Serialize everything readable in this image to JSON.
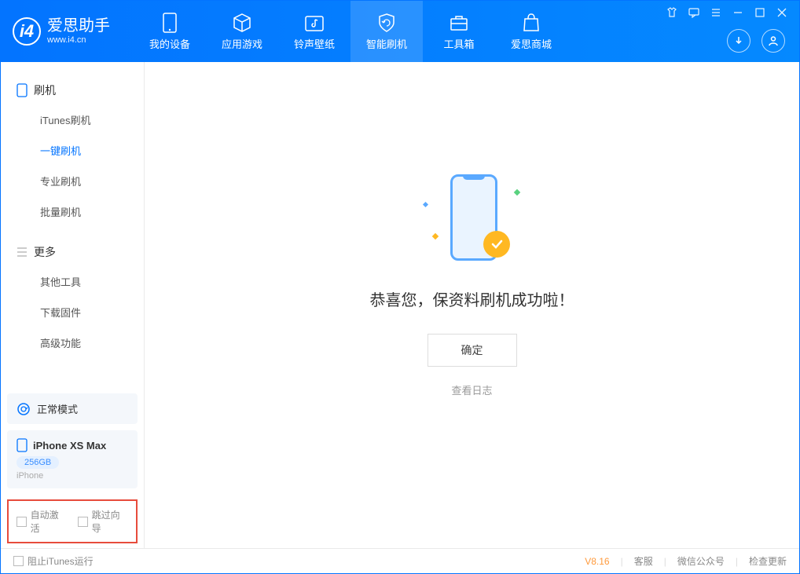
{
  "app": {
    "title": "爱思助手",
    "url": "www.i4.cn"
  },
  "tabs": [
    {
      "label": "我的设备"
    },
    {
      "label": "应用游戏"
    },
    {
      "label": "铃声壁纸"
    },
    {
      "label": "智能刷机"
    },
    {
      "label": "工具箱"
    },
    {
      "label": "爱思商城"
    }
  ],
  "sidebar": {
    "group1": {
      "title": "刷机",
      "items": [
        "iTunes刷机",
        "一键刷机",
        "专业刷机",
        "批量刷机"
      ]
    },
    "group2": {
      "title": "更多",
      "items": [
        "其他工具",
        "下载固件",
        "高级功能"
      ]
    },
    "status": "正常模式",
    "device": {
      "name": "iPhone XS Max",
      "storage": "256GB",
      "type": "iPhone"
    },
    "checks": [
      "自动激活",
      "跳过向导"
    ]
  },
  "content": {
    "title": "恭喜您，保资料刷机成功啦！",
    "ok": "确定",
    "log": "查看日志"
  },
  "footer": {
    "block": "阻止iTunes运行",
    "version": "V8.16",
    "links": [
      "客服",
      "微信公众号",
      "检查更新"
    ]
  }
}
